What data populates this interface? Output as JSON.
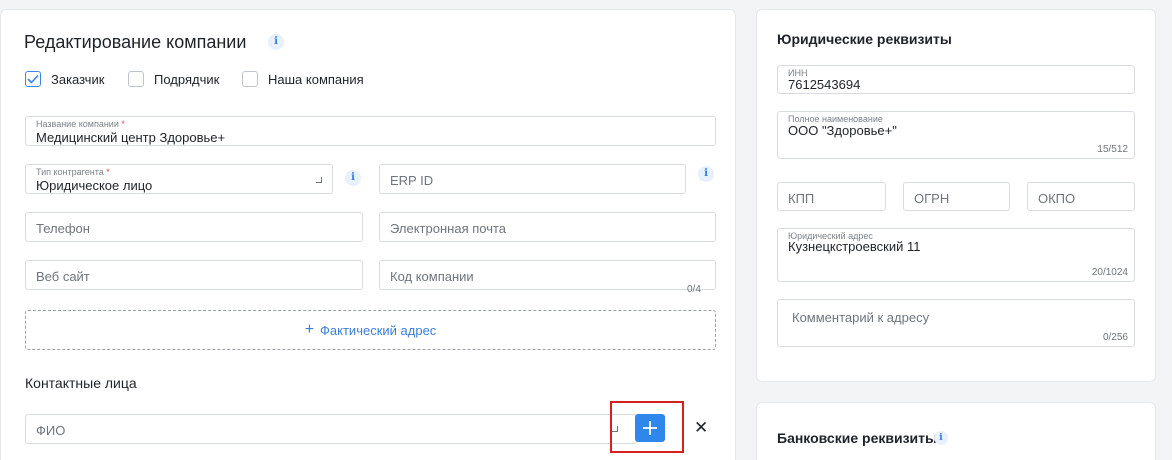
{
  "edit_card": {
    "title": "Редактирование компании",
    "role_options": [
      {
        "label": "Заказчик",
        "checked": true
      },
      {
        "label": "Подрядчик",
        "checked": false
      },
      {
        "label": "Наша компания",
        "checked": false
      }
    ],
    "company_name": {
      "label": "Название компании",
      "required_mark": "*",
      "value": "Медицинский центр Здоровье+"
    },
    "contractor_type": {
      "label": "Тип контрагента",
      "required_mark": "*",
      "value": "Юридическое лицо"
    },
    "erp_id": {
      "placeholder": "ERP ID"
    },
    "phone": {
      "placeholder": "Телефон"
    },
    "email": {
      "placeholder": "Электронная почта"
    },
    "website": {
      "placeholder": "Веб сайт"
    },
    "company_code": {
      "placeholder": "Код компании",
      "counter": "0/4"
    },
    "actual_address_button": "Фактический адрес",
    "contacts_title": "Контактные лица",
    "contact_fio": {
      "placeholder": "ФИО"
    }
  },
  "legal_card": {
    "title": "Юридические реквизиты",
    "inn": {
      "label": "ИНН",
      "value": "7612543694"
    },
    "full_name": {
      "label": "Полное наименование",
      "value": "ООО \"Здоровье+\"",
      "counter": "15/512"
    },
    "kpp": {
      "placeholder": "КПП"
    },
    "ogrn": {
      "placeholder": "ОГРН"
    },
    "okpo": {
      "placeholder": "ОКПО"
    },
    "legal_address": {
      "label": "Юридический адрес",
      "value": "Кузнецкстроевский 11",
      "counter": "20/1024"
    },
    "address_comment": {
      "placeholder": "Комментарий к адресу",
      "counter": "0/256"
    }
  },
  "bank_card": {
    "title": "Банковские реквизиты"
  },
  "icons": {
    "info": "info-icon",
    "check": "check-icon",
    "plus": "plus-icon",
    "close": "close-icon",
    "resize": "resize-corner-icon"
  },
  "colors": {
    "accent": "#2f86eb",
    "highlight": "#d71f1f",
    "required": "#e5484d"
  }
}
